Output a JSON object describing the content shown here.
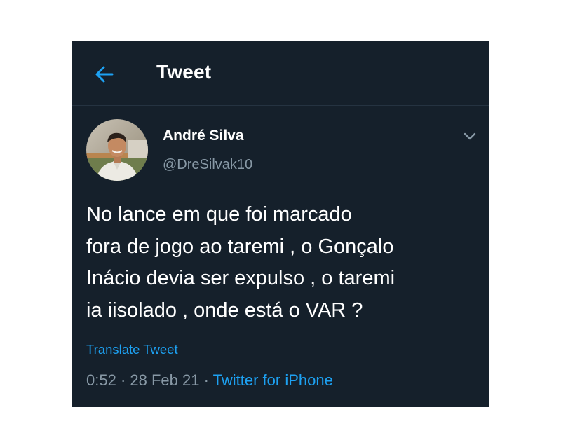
{
  "header": {
    "title": "Tweet",
    "back_icon": "arrow-left-icon"
  },
  "tweet": {
    "author": {
      "name": "André Silva",
      "handle": "@DreSilvak10",
      "avatar_icon": "user-avatar"
    },
    "caret_icon": "chevron-down-icon",
    "text_lines": [
      "No lance em que foi marcado",
      "fora de jogo ao taremi , o Gonçalo",
      "Inácio devia ser expulso , o taremi",
      "ia iisolado , onde está o VAR ?"
    ],
    "translate_label": "Translate Tweet",
    "time": "0:52",
    "separator": "·",
    "date": "28 Feb 21",
    "source": "Twitter for iPhone"
  },
  "colors": {
    "background": "#15202b",
    "accent": "#1da1f2",
    "secondary_text": "#8899a6",
    "divider": "#253341"
  }
}
